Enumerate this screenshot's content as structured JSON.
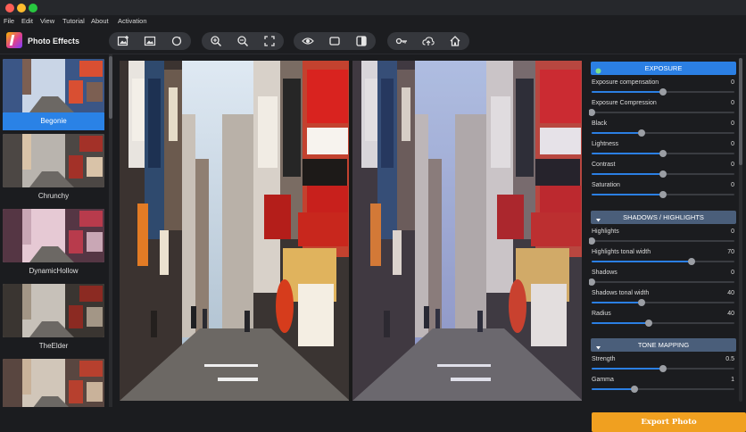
{
  "window": {
    "traffic_lights": [
      "close",
      "minimize",
      "zoom"
    ]
  },
  "menu": [
    "File",
    "Edit",
    "View",
    "Tutorial",
    "About",
    "Activation"
  ],
  "app": {
    "title": "Photo Effects"
  },
  "toolbar": {
    "group1": [
      "add-image-icon",
      "image-icon",
      "reset-icon"
    ],
    "group2": [
      "zoom-in-icon",
      "zoom-out-icon",
      "fit-screen-icon"
    ],
    "group3": [
      "eye-icon",
      "frame-icon",
      "split-view-icon"
    ],
    "group4": [
      "key-icon",
      "upload-icon",
      "home-icon"
    ]
  },
  "presets": [
    {
      "label": "Begonie",
      "selected": true
    },
    {
      "label": "Chrunchy",
      "selected": false
    },
    {
      "label": "DynamicHollow",
      "selected": false
    },
    {
      "label": "TheElder",
      "selected": false
    },
    {
      "label": "",
      "selected": false
    }
  ],
  "panel": {
    "sections": [
      {
        "title": "EXPOSURE",
        "sliders": [
          {
            "label": "Exposure compensation",
            "value": "0",
            "fraction": 0.5
          },
          {
            "label": "Exposure Compression",
            "value": "0",
            "fraction": 0.0
          },
          {
            "label": "Black",
            "value": "0",
            "fraction": 0.35
          },
          {
            "label": "Lightness",
            "value": "0",
            "fraction": 0.5
          },
          {
            "label": "Contrast",
            "value": "0",
            "fraction": 0.5
          },
          {
            "label": "Saturation",
            "value": "0",
            "fraction": 0.5
          }
        ]
      },
      {
        "title": "SHADOWS / HIGHLIGHTS",
        "sliders": [
          {
            "label": "Highlights",
            "value": "0",
            "fraction": 0.0
          },
          {
            "label": "Highlights tonal width",
            "value": "70",
            "fraction": 0.7
          },
          {
            "label": "Shadows",
            "value": "0",
            "fraction": 0.0
          },
          {
            "label": "Shadows tonal width",
            "value": "40",
            "fraction": 0.35
          },
          {
            "label": "Radius",
            "value": "40",
            "fraction": 0.4
          }
        ]
      },
      {
        "title": "TONE MAPPING",
        "sliders": [
          {
            "label": "Strength",
            "value": "0.5",
            "fraction": 0.5
          },
          {
            "label": "Gamma",
            "value": "1",
            "fraction": 0.3
          }
        ]
      }
    ]
  },
  "export": {
    "label": "Export Photo"
  },
  "colors": {
    "accent": "#2b7fe3",
    "export": "#f0a020",
    "background": "#1b1c1f"
  }
}
